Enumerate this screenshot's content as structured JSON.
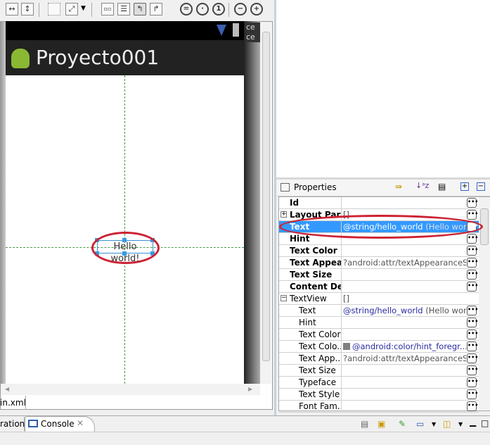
{
  "toolbar": {
    "icons": [
      "fit-width-icon",
      "fit-height-icon",
      "select-icon",
      "fit-icon",
      "dropdown-icon",
      "layout-a-icon",
      "layout-b-icon",
      "layout-c-icon",
      "layout-d-icon",
      "zoom-fit-icon",
      "zoom-real-icon",
      "zoom-100-icon",
      "zoom-out-icon",
      "zoom-in-icon"
    ]
  },
  "device": {
    "app_title": "Proyecto001",
    "side_text": "ce\nce",
    "widget_text": "Hello world!"
  },
  "editor_tab": "in.xml",
  "properties": {
    "title": "Properties",
    "rows": [
      {
        "name": "Id",
        "value": "",
        "bold": true
      },
      {
        "name": "Layout Par",
        "value": "[]",
        "bold": true,
        "expander": "+"
      },
      {
        "name": "Text",
        "value": "@string/hello_world",
        "extra": "(Hello wor...",
        "bold": true,
        "selected": true
      },
      {
        "name": "Hint",
        "value": "",
        "bold": true
      },
      {
        "name": "Text Color",
        "value": "",
        "bold": true
      },
      {
        "name": "Text Appea...",
        "value": "?android:attr/textAppearanceS...",
        "bold": true
      },
      {
        "name": "Text Size",
        "value": "",
        "bold": true
      },
      {
        "name": "Content De...",
        "value": "",
        "bold": true
      },
      {
        "name": "TextView",
        "value": "[]",
        "expander": "-",
        "group": true
      },
      {
        "name": "Text",
        "value": "@string/hello_world",
        "extra": "(Hello wor...",
        "sub": true
      },
      {
        "name": "Hint",
        "value": "",
        "sub": true
      },
      {
        "name": "Text Color",
        "value": "",
        "sub": true
      },
      {
        "name": "Text Colo...",
        "value": "@android:color/hint_foregr...",
        "swatch": "#808080",
        "sub": true
      },
      {
        "name": "Text App...",
        "value": "?android:attr/textAppearanceS...",
        "sub": true
      },
      {
        "name": "Text Size",
        "value": "",
        "sub": true
      },
      {
        "name": "Typeface",
        "value": "",
        "sub": true
      },
      {
        "name": "Text Style",
        "value": "",
        "sub": true
      },
      {
        "name": "Font Fam...",
        "value": "",
        "sub": true
      }
    ]
  },
  "bottom": {
    "tab_prev": "ration",
    "tab_console": "Console"
  },
  "colors": {
    "selection": "#3399ff",
    "annotation": "#cc2233",
    "guide": "#4a9a4a"
  }
}
